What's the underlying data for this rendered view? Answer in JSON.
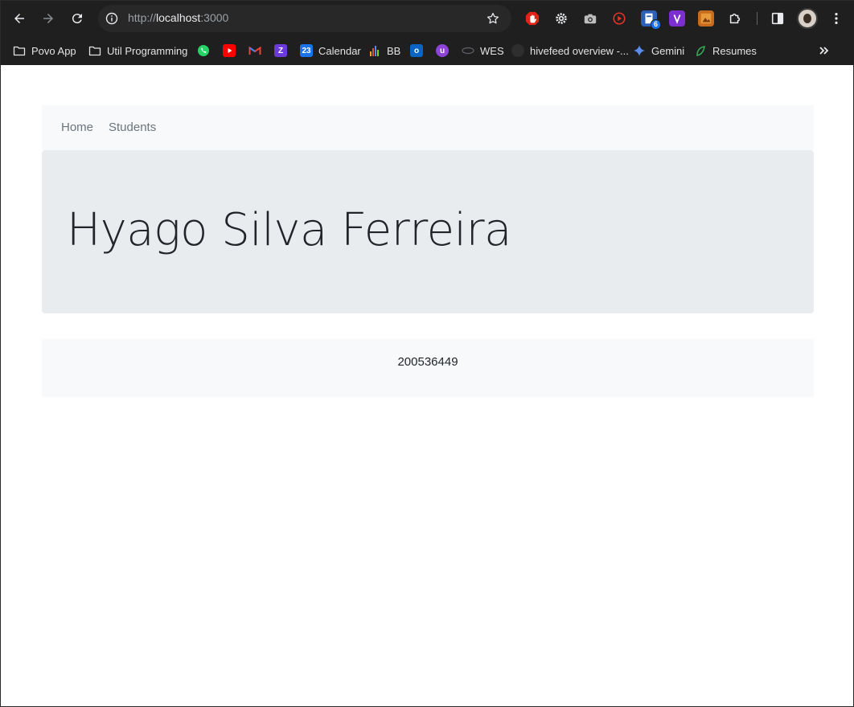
{
  "browser": {
    "url_scheme": "http://",
    "url_host": "localhost",
    "url_port": ":3000",
    "extensions": [
      "adblock-icon",
      "gear-icon",
      "camera-icon",
      "record-icon",
      "extension-badge-icon",
      "v-extension-icon",
      "photo-extension-icon",
      "puzzle-icon"
    ],
    "extension_badge": "6",
    "bookmarks": [
      {
        "label": "Povo App",
        "icon": "folder-icon"
      },
      {
        "label": "Util Programming",
        "icon": "folder-icon"
      },
      {
        "label": "Calendar",
        "icon": "calendar-icon"
      },
      {
        "label": "BB",
        "icon": "bar-chart-icon"
      },
      {
        "label": "WES",
        "icon": "wes-icon"
      },
      {
        "label": "hivefeed overview -...",
        "icon": "hivefeed-icon"
      },
      {
        "label": "Gemini",
        "icon": "gemini-icon"
      },
      {
        "label": "Resumes",
        "icon": "leaf-icon"
      }
    ]
  },
  "nav": {
    "home": "Home",
    "students": "Students"
  },
  "student": {
    "name": "Hyago Silva Ferreira",
    "id": "200536449"
  },
  "colors": {
    "chrome_bg": "#1f1f1f",
    "navbar_bg": "#f8f9fa",
    "jumbotron_bg": "#e9ecef",
    "text": "#212529",
    "muted": "#6c757d"
  }
}
